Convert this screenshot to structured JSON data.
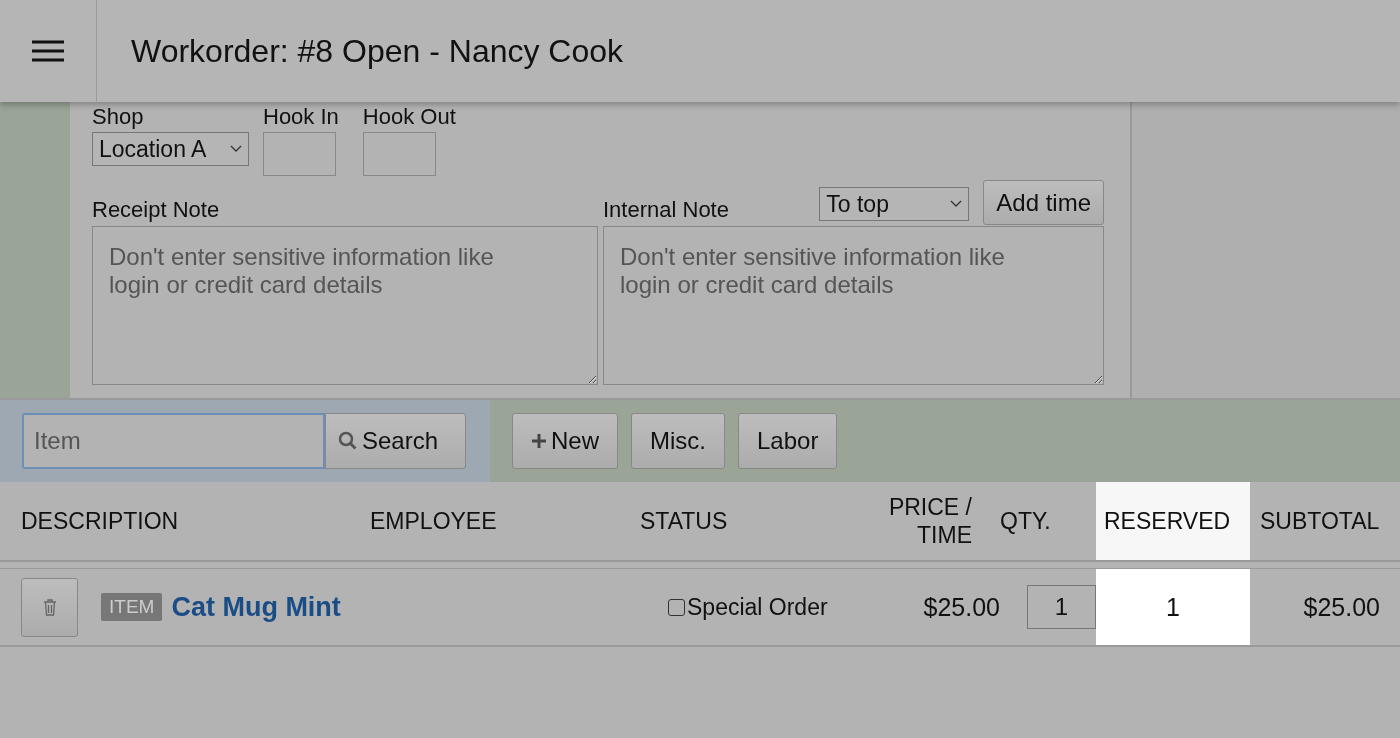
{
  "header": {
    "title": "Workorder: #8 Open - Nancy Cook"
  },
  "form": {
    "shop": {
      "label": "Shop",
      "value": "Location A"
    },
    "hook_in": {
      "label": "Hook In"
    },
    "hook_out": {
      "label": "Hook Out"
    },
    "receipt_note": {
      "label": "Receipt Note",
      "placeholder": "Don't enter sensitive information like login or credit card details"
    },
    "internal_note": {
      "label": "Internal Note",
      "placeholder": "Don't enter sensitive information like login or credit card details"
    },
    "position_select": {
      "value": "To top"
    },
    "add_time_button": "Add time"
  },
  "toolbar": {
    "search": {
      "placeholder": "Item",
      "button": "Search"
    },
    "buttons": [
      {
        "label": "New",
        "kind": "new"
      },
      {
        "label": "Misc.",
        "kind": "plain"
      },
      {
        "label": "Labor",
        "kind": "plain"
      }
    ]
  },
  "table": {
    "columns": [
      {
        "label": "DESCRIPTION",
        "highlighted": false
      },
      {
        "label": "EMPLOYEE",
        "highlighted": false
      },
      {
        "label": "STATUS",
        "highlighted": false
      },
      {
        "label": "PRICE / TIME",
        "highlighted": false
      },
      {
        "label": "QTY.",
        "highlighted": false
      },
      {
        "label": "RESERVED",
        "highlighted": true
      },
      {
        "label": "SUBTOTAL",
        "highlighted": false
      }
    ],
    "rows": [
      {
        "badge": "ITEM",
        "name": "Cat Mug Mint",
        "special_order": false,
        "status_label": "Special Order",
        "price": "$25.00",
        "qty": "1",
        "reserved": "1",
        "subtotal": "$25.00"
      }
    ]
  }
}
